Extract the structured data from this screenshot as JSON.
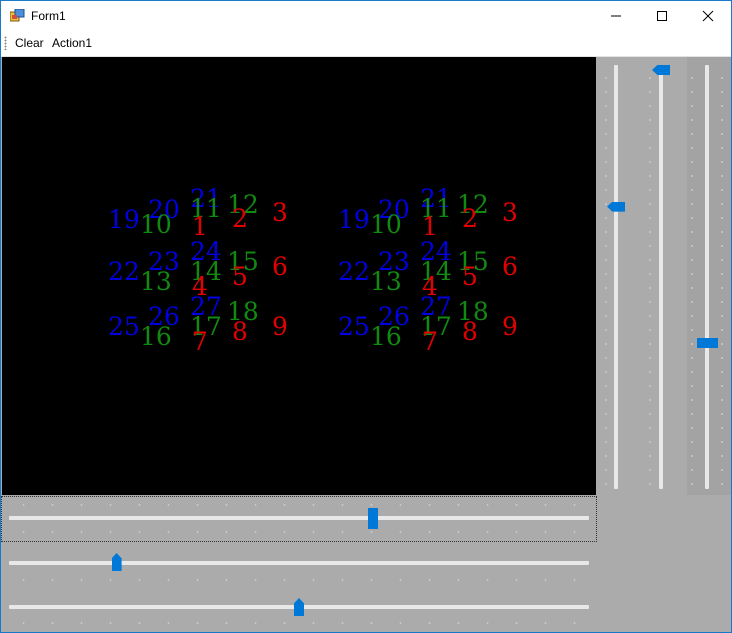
{
  "window": {
    "title": "Form1"
  },
  "controls": {
    "minimize": "—",
    "maximize": "☐",
    "close": "✕"
  },
  "menu": {
    "items": [
      "Clear",
      "Action1"
    ]
  },
  "canvas": {
    "background": "#000000",
    "colors": {
      "red": "#e30000",
      "green": "#118a11",
      "blue": "#0000e0"
    },
    "numbers": {
      "n1": "1",
      "n2": "2",
      "n3": "3",
      "n4": "4",
      "n5": "5",
      "n6": "6",
      "n7": "7",
      "n8": "8",
      "n9": "9",
      "n10": "10",
      "n11": "11",
      "n12": "12",
      "n13": "13",
      "n14": "14",
      "n15": "15",
      "n16": "16",
      "n17": "17",
      "n18": "18",
      "n19": "19",
      "n20": "20",
      "n21": "21",
      "n22": "22",
      "n23": "23",
      "n24": "24",
      "n25": "25",
      "n26": "26",
      "n27": "27"
    }
  },
  "sliders": {
    "vertical_1": {
      "value": 0.33,
      "orientation": "vertical"
    },
    "vertical_2": {
      "value": 0.0,
      "orientation": "vertical"
    },
    "vertical_3": {
      "value": 0.66,
      "orientation": "vertical"
    },
    "horizontal_1": {
      "value": 0.63,
      "orientation": "horizontal",
      "focused": true
    },
    "horizontal_2": {
      "value": 0.18,
      "orientation": "horizontal"
    },
    "horizontal_3": {
      "value": 0.5,
      "orientation": "horizontal"
    }
  }
}
